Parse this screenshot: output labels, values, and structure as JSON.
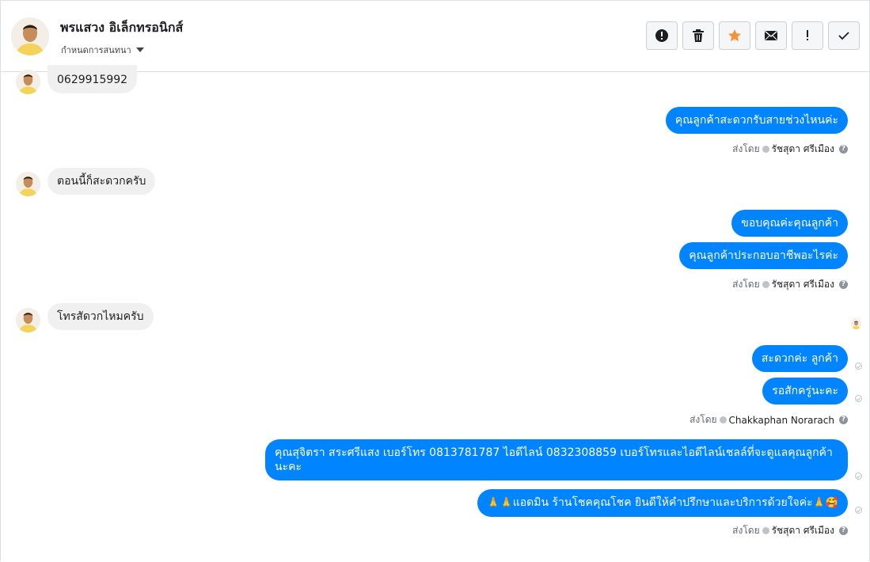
{
  "contact": {
    "name": "พรแสวง อิเล็กทรอนิกส์",
    "assign_label": "กำหนดการสนทนา"
  },
  "toolbar": {
    "buttons": [
      {
        "name": "spam",
        "icon": "alert-circle-icon"
      },
      {
        "name": "delete",
        "icon": "trash-icon"
      },
      {
        "name": "star",
        "icon": "star-icon"
      },
      {
        "name": "mark-unread",
        "icon": "envelope-icon"
      },
      {
        "name": "follow-up",
        "icon": "exclamation-icon"
      },
      {
        "name": "done",
        "icon": "check-icon"
      }
    ]
  },
  "colors": {
    "outgoing_bubble": "#0084ff",
    "incoming_bubble": "#f1f0f0",
    "star": "#f7923b"
  },
  "messages": {
    "m1": "0629915992",
    "m2": "คุณลูกค้าสะดวกรับสายช่วงไหนค่ะ",
    "m3": "ตอนนี้ก็สะดวกครับ",
    "m4": "ขอบคุณค่ะคุณลูกค้า",
    "m5": "คุณลูกค้าประกอบอาชีพอะไรค่ะ",
    "m6": "โทรสัดวกไหมครับ",
    "m7": "สะดวกค่ะ ลูกค้า",
    "m8": "รอสักครู่นะคะ",
    "m9": "คุณสุจิตรา สระศรีแสง      เบอร์โทร 0813781787  ไอดีไลน์ 0832308859   เบอร์โทรและไอดีไลน์เชลล์ที่จะดูแลคุณลูกค้านะคะ",
    "m10": "แอดมิน ร้านโชคคุณโชค ยินดีให้คำปรึกษาและบริการด้วยใจค่ะ"
  },
  "meta": {
    "sent_by": "ส่งโดย",
    "agent1": "รัชสุดา ศรีเมือง",
    "agent2": "Chakkaphan Norarach",
    "help": "?"
  }
}
